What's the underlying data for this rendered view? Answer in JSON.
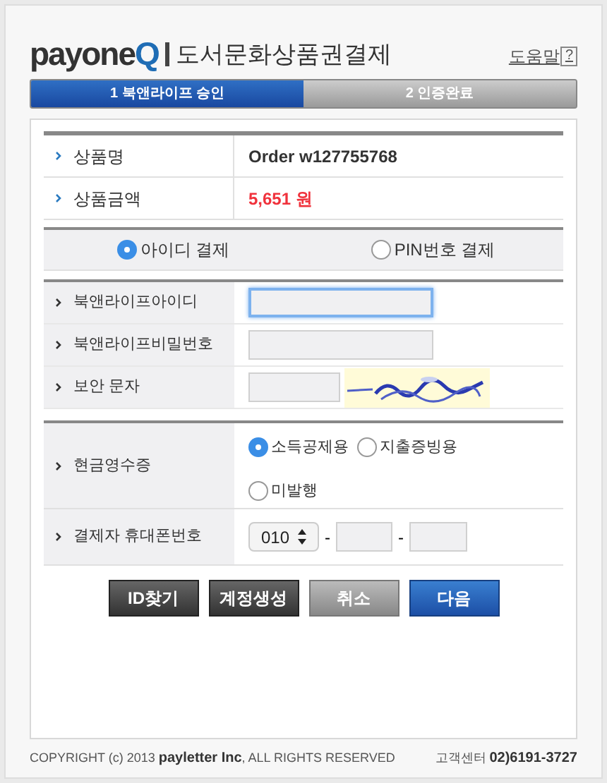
{
  "header": {
    "logo_main": "payone",
    "logo_accent": "Q",
    "title": "도서문화상품권결제",
    "help": "도움말",
    "help_mark": "?"
  },
  "steps": [
    {
      "label": "1 북앤라이프 승인",
      "selected": true
    },
    {
      "label": "2 인증완료",
      "selected": false
    }
  ],
  "product": [
    {
      "label": "상품명",
      "value": "Order w127755768",
      "kind": "name"
    },
    {
      "label": "상품금액",
      "value": "5,651 원",
      "kind": "price"
    }
  ],
  "pay_methods": [
    {
      "label": "아이디 결제",
      "selected": true
    },
    {
      "label": "PIN번호 결제",
      "selected": false
    }
  ],
  "login": [
    {
      "label": "북앤라이프아이디",
      "kind": "input",
      "focused": true
    },
    {
      "label": "북앤라이프비밀번호",
      "kind": "input",
      "focused": false
    },
    {
      "label": "보안 문자",
      "kind": "captcha",
      "focused": false
    }
  ],
  "receipt": {
    "label": "현금영수증",
    "options": [
      {
        "label": "소득공제용",
        "selected": true
      },
      {
        "label": "지출증빙용",
        "selected": false
      },
      {
        "label": "미발행",
        "selected": false
      }
    ]
  },
  "phone": {
    "label": "결제자 휴대폰번호",
    "prefix": "010",
    "separator": "-"
  },
  "buttons": [
    {
      "label": "ID찾기",
      "kind": "dark"
    },
    {
      "label": "계정생성",
      "kind": "dark"
    },
    {
      "label": "취소",
      "kind": "gray"
    },
    {
      "label": "다음",
      "kind": "blue"
    }
  ],
  "footer": {
    "copyright_prefix": "COPYRIGHT (c) 2013",
    "company": "payletter Inc",
    "copyright_suffix": ", ALL RIGHTS RESERVED",
    "support_label": "고객센터",
    "support_phone": "02)6191-3727"
  }
}
